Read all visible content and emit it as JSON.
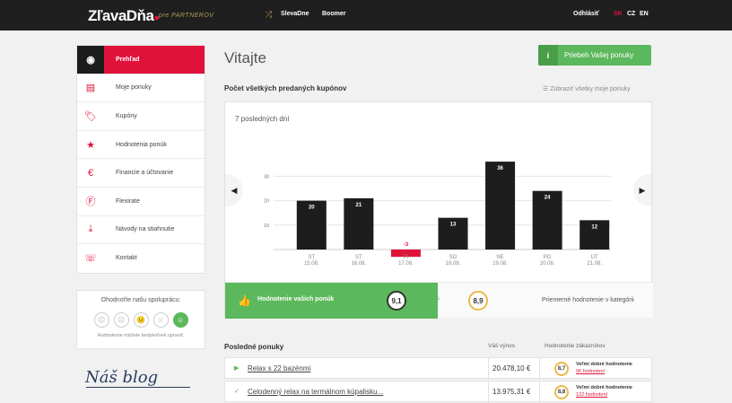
{
  "header": {
    "logo": "ZľavaDňa",
    "logo_sub": "pre PARTNEROV",
    "nav": [
      "SlevaDne",
      "Boomer"
    ],
    "logout": "Odhlásiť",
    "langs": [
      "SK",
      "CZ",
      "EN"
    ],
    "active_lang": "SK"
  },
  "sidebar": {
    "items": [
      {
        "label": "Prehľad",
        "icon": "eye-icon",
        "active": true
      },
      {
        "label": "Moje ponuky",
        "icon": "list-icon"
      },
      {
        "label": "Kupóny",
        "icon": "tag-icon"
      },
      {
        "label": "Hodnotenia ponúk",
        "icon": "star-icon"
      },
      {
        "label": "Financie a účtovanie",
        "icon": "euro-icon"
      },
      {
        "label": "Flexirate",
        "icon": "flexirate-icon"
      },
      {
        "label": "Návody na stiahnutie",
        "icon": "download-icon"
      },
      {
        "label": "Kontakt",
        "icon": "phone-icon"
      }
    ]
  },
  "rating_widget": {
    "title": "Ohodnoťte našu spoluprácu:",
    "note": "Hodnotenie môžete kedykoľvek upraviť."
  },
  "blog": {
    "label": "Náš blog"
  },
  "main": {
    "title": "Vitajte",
    "cta": "Priebeh Vašej ponuky",
    "cta_icon": "i",
    "section_title": "Počet všetkých predaných kupónov",
    "show_all": "Zobraziť všetky moje ponuky",
    "chart_subtitle": "7 posledných dní"
  },
  "chart_data": {
    "type": "bar",
    "categories": [
      "ST 15.08.",
      "ST 16.08.",
      "PI 17.08.",
      "SO 18.08.",
      "NE 19.08.",
      "PO 20.08.",
      "UT 21.08."
    ],
    "days": [
      "ST",
      "ST",
      "PI",
      "SO",
      "NE",
      "PO",
      "UT"
    ],
    "dates": [
      "15.08.",
      "16.08.",
      "17.08.",
      "18.08.",
      "19.08.",
      "20.08.",
      "21.08."
    ],
    "values": [
      20,
      21,
      -3,
      13,
      36,
      24,
      12
    ],
    "yticks": [
      10,
      20,
      30
    ],
    "ylim": [
      -3,
      37
    ],
    "grid": true,
    "bar_color": "#1d1d1d",
    "negative_color": "#e0123a"
  },
  "ratings": {
    "label": "Hodnotenie vašich ponúk",
    "yours": "9,1",
    "vs": "vs",
    "category": "8,9",
    "category_label": "Priemerné hodnotenie v kategórii"
  },
  "offers": {
    "title": "Posledné ponuky",
    "col_revenue": "Váš výnos",
    "col_rating": "Hodnotenie zákazníkov",
    "rows": [
      {
        "name": "Relax s 22 bazénmi",
        "revenue": "20.478,10 €",
        "score": "8,7",
        "rating_text": "Veľmi dobré hodnotenie",
        "count": "96 hodnotení",
        "mark": "▶"
      },
      {
        "name": "Celodenný relax na termálnom kúpalisku...",
        "revenue": "13.975,31 €",
        "score": "8,8",
        "rating_text": "Veľmi dobré hodnotenie",
        "count": "122 hodnotení",
        "mark": "✓"
      }
    ]
  },
  "colors": {
    "brand": "#e0123a",
    "green": "#5cb85c",
    "dark": "#1f1f1f"
  }
}
